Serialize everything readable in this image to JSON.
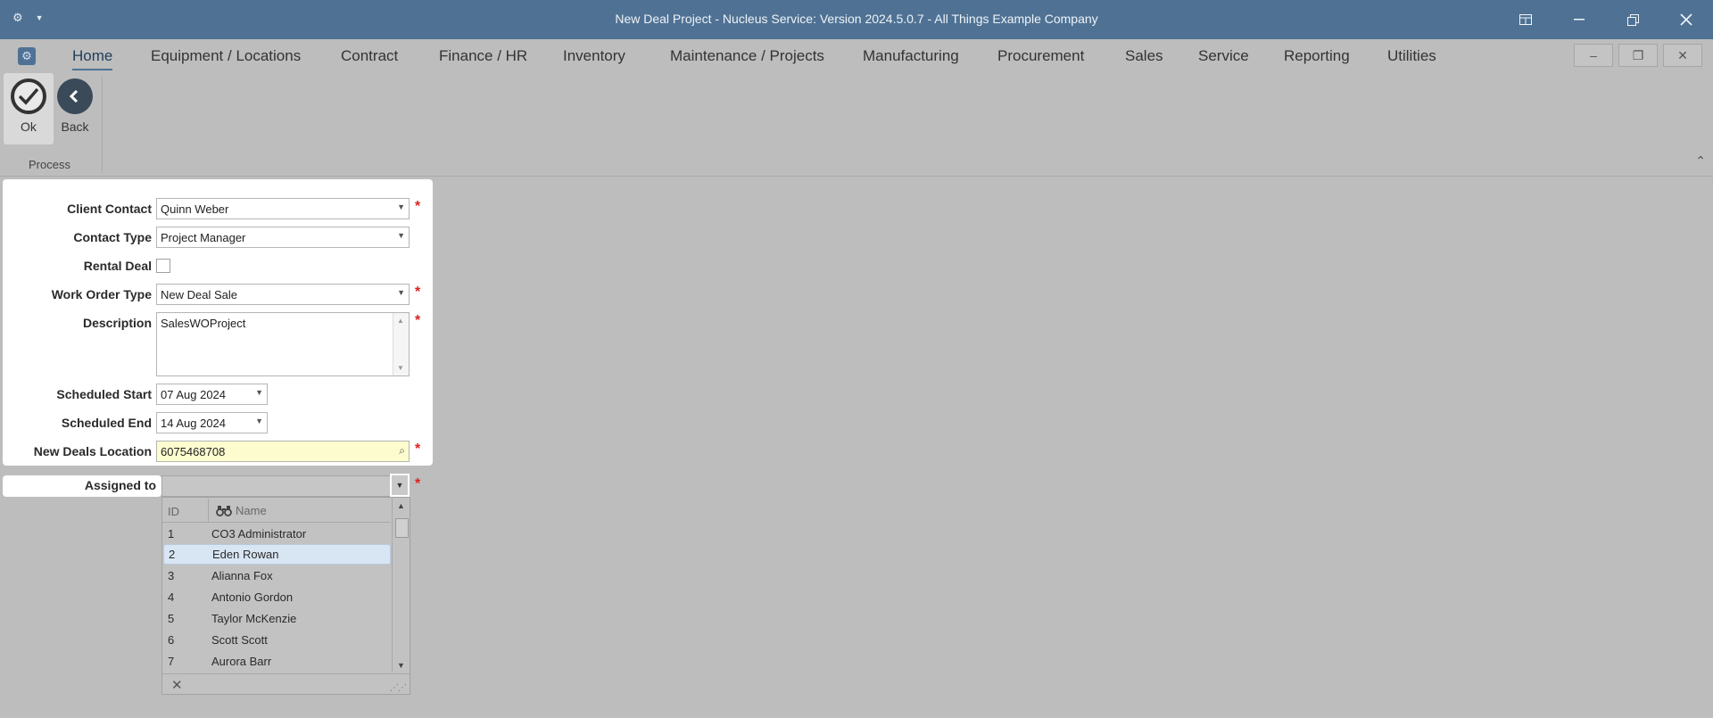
{
  "window": {
    "title": "New Deal Project - Nucleus Service: Version 2024.5.0.7 - All Things Example Company"
  },
  "menu": {
    "items": [
      "Home",
      "Equipment / Locations",
      "Contract",
      "Finance / HR",
      "Inventory",
      "Maintenance / Projects",
      "Manufacturing",
      "Procurement",
      "Sales",
      "Service",
      "Reporting",
      "Utilities"
    ]
  },
  "ribbon": {
    "ok_label": "Ok",
    "back_label": "Back",
    "group_label": "Process"
  },
  "form": {
    "client_contact": {
      "label": "Client Contact",
      "value": "Quinn Weber"
    },
    "contact_type": {
      "label": "Contact Type",
      "value": "Project Manager"
    },
    "rental_deal": {
      "label": "Rental Deal",
      "checked": false
    },
    "work_order_type": {
      "label": "Work Order Type",
      "value": "New Deal Sale"
    },
    "description": {
      "label": "Description",
      "value": "SalesWOProject"
    },
    "scheduled_start": {
      "label": "Scheduled Start",
      "value": "07 Aug 2024"
    },
    "scheduled_end": {
      "label": "Scheduled End",
      "value": "14 Aug 2024"
    },
    "new_deals_location": {
      "label": "New Deals Location",
      "value": "6075468708"
    },
    "assigned_to": {
      "label": "Assigned to",
      "value": ""
    },
    "required_mark": "*"
  },
  "assigned_popup": {
    "columns": {
      "id": "ID",
      "name": "Name"
    },
    "rows": [
      {
        "id": "1",
        "name": "CO3 Administrator"
      },
      {
        "id": "2",
        "name": "Eden Rowan"
      },
      {
        "id": "3",
        "name": "Alianna Fox"
      },
      {
        "id": "4",
        "name": "Antonio Gordon"
      },
      {
        "id": "5",
        "name": "Taylor McKenzie"
      },
      {
        "id": "6",
        "name": "Scott Scott"
      },
      {
        "id": "7",
        "name": "Aurora Barr"
      }
    ],
    "selected_id": "2"
  },
  "colors": {
    "titlebar": "#4f7294",
    "background": "#bdbdbd",
    "required": "#dd2222",
    "highlight_field": "#fdfccf",
    "selected_row": "#d8e6f4"
  }
}
